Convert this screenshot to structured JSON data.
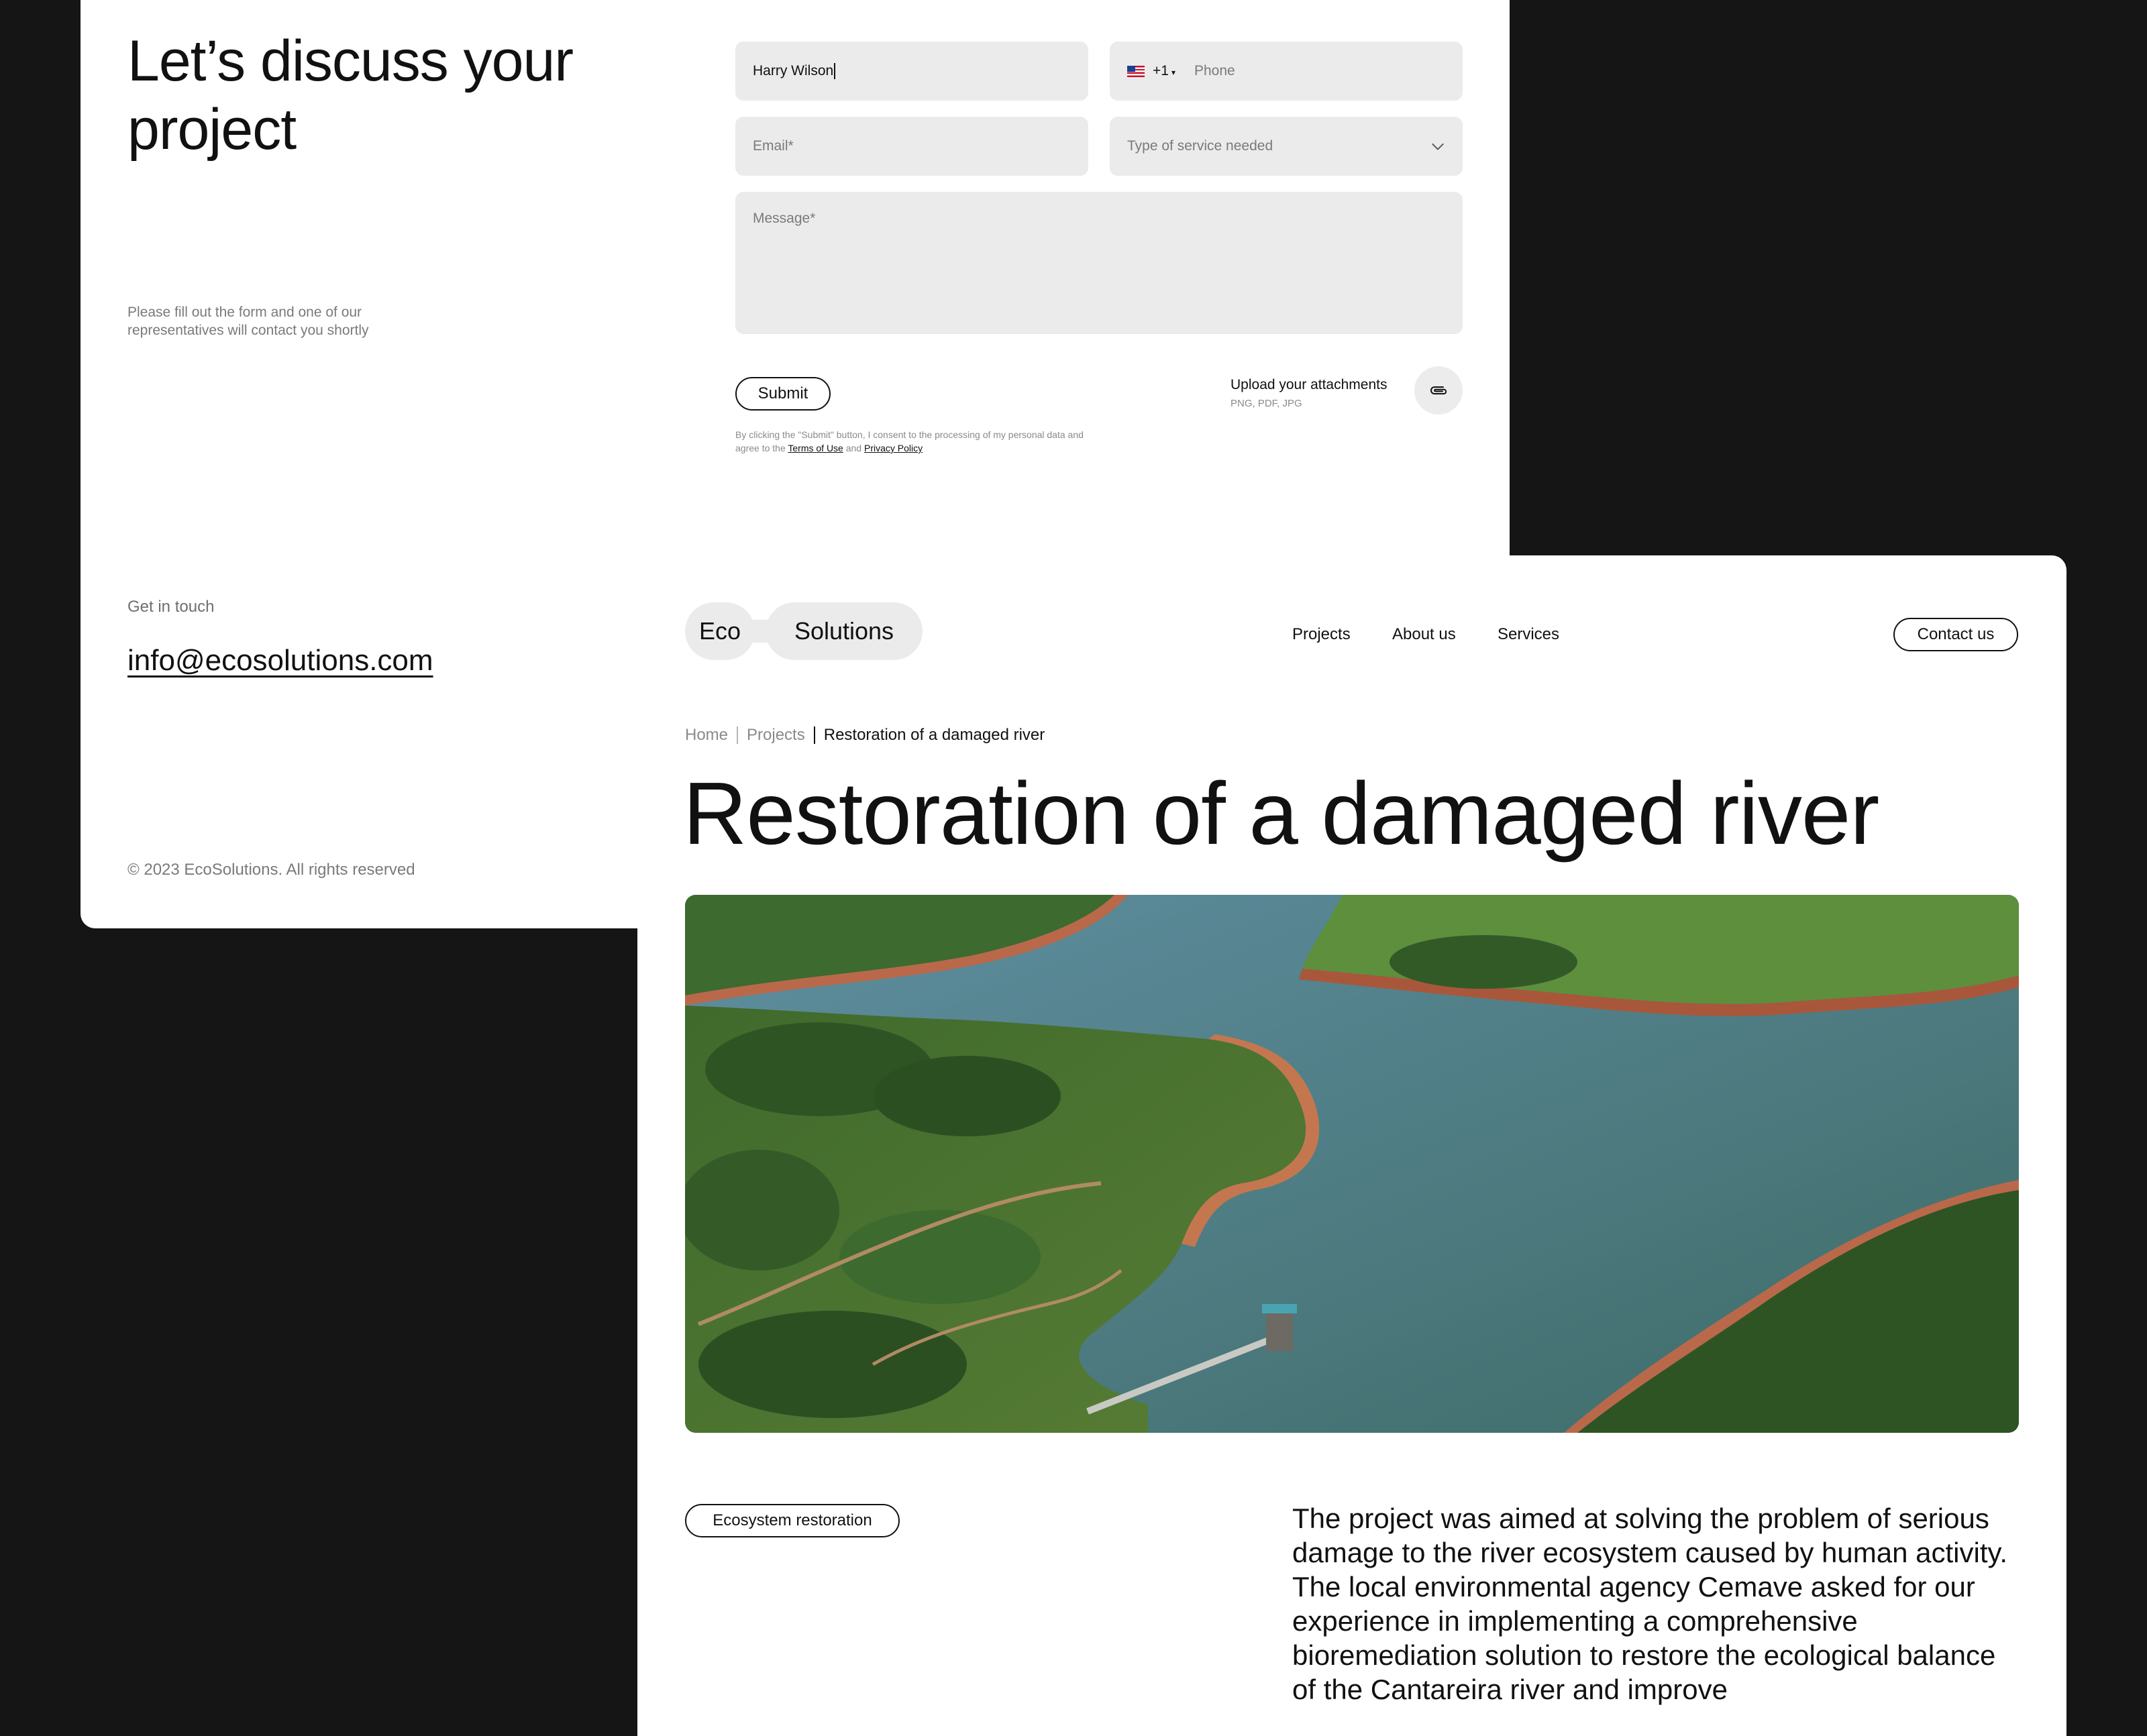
{
  "contact_form": {
    "title": "Let’s discuss your project",
    "note": "Please fill out the form and one of our representatives will contact you shortly",
    "name_value": "Harry Wilson",
    "phone_code": "+1",
    "phone_placeholder": "Phone",
    "email_placeholder": "Email*",
    "service_placeholder": "Type of service needed",
    "message_placeholder": "Message*",
    "submit_label": "Submit",
    "upload_title": "Upload your attachments",
    "upload_formats": "PNG, PDF, JPG",
    "consent_text": "By clicking the \"Submit\" button, I consent to the processing of my personal data and agree to the",
    "terms_link": "Terms of Use",
    "consent_and": "and",
    "privacy_link": "Privacy Policy"
  },
  "footer": {
    "get_in_touch": "Get in touch",
    "email": "info@ecosolutions.com",
    "copyright": "© 2023 EcoSolutions. All rights reserved"
  },
  "header": {
    "logo_part1": "Eco",
    "logo_part2": "Solutions",
    "nav": [
      "Projects",
      "About us",
      "Services"
    ],
    "contact_label": "Contact us"
  },
  "breadcrumb": {
    "home": "Home",
    "projects": "Projects",
    "current": "Restoration of a damaged river"
  },
  "project": {
    "title": "Restoration of a damaged river",
    "tag": "Ecosystem restoration",
    "description": "The project was aimed at solving the problem of serious damage to the river ecosystem caused by human activity. The local environmental agency Cemave asked for our experience in implementing a comprehensive bioremediation solution to restore the ecological balance of the Cantareira river and improve"
  },
  "icons": {
    "flag": "us-flag-icon",
    "dropdown": "chevron-down-icon",
    "attach": "paperclip-icon"
  },
  "colors": {
    "background": "#151515",
    "card": "#ffffff",
    "field": "#ebebeb",
    "text": "#111111",
    "muted": "#7a7a7a"
  }
}
